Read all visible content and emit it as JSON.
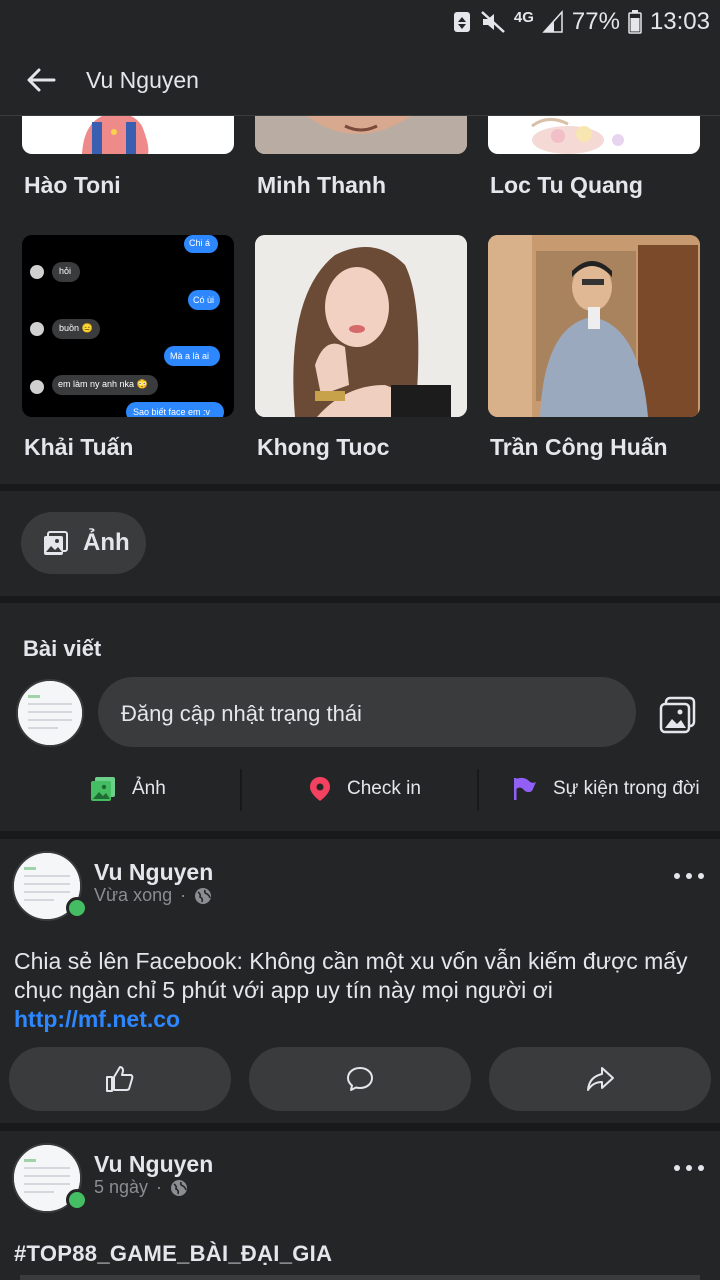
{
  "status_bar": {
    "network": "4G",
    "battery": "77%",
    "time": "13:03",
    "icons": [
      "recycle-icon",
      "mute-icon",
      "signal-icon",
      "battery-icon"
    ]
  },
  "header": {
    "title": "Vu Nguyen",
    "back_icon": "arrow-left-icon"
  },
  "friends": {
    "items": [
      {
        "name": "Hào Toni"
      },
      {
        "name": "Minh Thanh"
      },
      {
        "name": "Loc Tu Quang"
      },
      {
        "name": "Khải Tuấn"
      },
      {
        "name": "Khong Tuoc"
      },
      {
        "name": "Trần Công Huấn"
      }
    ],
    "chat_preview": [
      {
        "side": "right",
        "text": "Chi á"
      },
      {
        "side": "left",
        "text": "hỏi"
      },
      {
        "side": "right",
        "text": "Có ùi"
      },
      {
        "side": "left",
        "text": "buồn 😑"
      },
      {
        "side": "right",
        "text": "Mà a là ai"
      },
      {
        "side": "left",
        "text": "em làm ny anh nka 😳"
      },
      {
        "side": "right",
        "text": "Sao biết face em :v"
      }
    ]
  },
  "photos_chip": {
    "label": "Ảnh"
  },
  "posts_section": {
    "title": "Bài viết",
    "composer_placeholder": "Đăng cập nhật trạng thái",
    "actions": [
      {
        "label": "Ảnh",
        "icon": "photo-icon",
        "color": "#45bd62"
      },
      {
        "label": "Check in",
        "icon": "location-pin-icon",
        "color": "#f3425f"
      },
      {
        "label": "Sự kiện trong đời",
        "icon": "flag-icon",
        "color": "#9360f7"
      }
    ]
  },
  "posts": [
    {
      "author": "Vu Nguyen",
      "time": "Vừa xong",
      "separator": "·",
      "privacy_icon": "globe-icon",
      "text": "Chia sẻ lên Facebook: Không cần một xu vốn vẫn kiếm được mấy chục ngàn chỉ 5 phút với app uy tín này mọi người ơi ",
      "link": "http://mf.net.co",
      "buttons": [
        "like-icon",
        "comment-icon",
        "share-icon"
      ]
    },
    {
      "author": "Vu Nguyen",
      "time": "5 ngày",
      "separator": "·",
      "privacy_icon": "globe-icon",
      "text": "#TOP88_GAME_BÀI_ĐẠI_GIA"
    }
  ],
  "colors": {
    "background": "#18191a",
    "surface": "#242526",
    "chip": "#3a3b3c",
    "link": "#2d88ff",
    "online": "#45bd62"
  }
}
